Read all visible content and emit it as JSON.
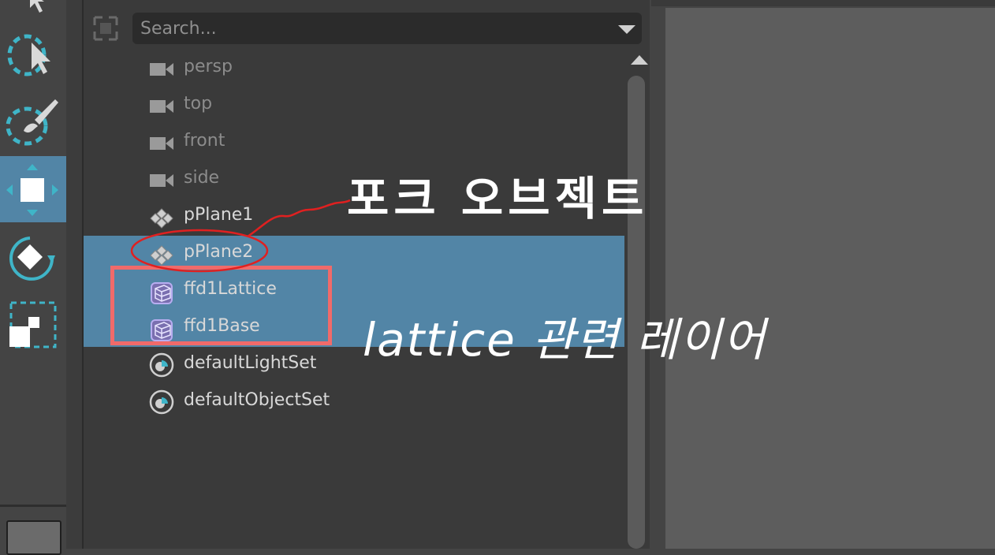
{
  "search": {
    "placeholder": "Search..."
  },
  "outliner_items": [
    {
      "label": "persp",
      "icon": "camera-icon",
      "dim": true
    },
    {
      "label": "top",
      "icon": "camera-icon",
      "dim": true
    },
    {
      "label": "front",
      "icon": "camera-icon",
      "dim": true
    },
    {
      "label": "side",
      "icon": "camera-icon",
      "dim": true
    },
    {
      "label": "pPlane1",
      "icon": "mesh-icon",
      "dim": false
    },
    {
      "label": "pPlane2",
      "icon": "mesh-icon",
      "dim": false,
      "selected": true
    },
    {
      "label": "ffd1Lattice",
      "icon": "lattice-icon",
      "dim": false,
      "selected": true
    },
    {
      "label": "ffd1Base",
      "icon": "lattice-icon",
      "dim": false,
      "selected": true
    },
    {
      "label": "defaultLightSet",
      "icon": "set-icon",
      "dim": false
    },
    {
      "label": "defaultObjectSet",
      "icon": "set-icon",
      "dim": false
    }
  ],
  "annotations": {
    "fork_object": "포크 오브젝트",
    "lattice_layers": "lattice 관련 레이어"
  },
  "colors": {
    "selection": "#5285a6",
    "highlight_box": "#f06a6a",
    "circle_mark": "#e02020"
  },
  "tools": [
    "select-tool-icon",
    "lasso-tool-icon",
    "paint-select-tool-icon",
    "move-tool-icon",
    "rotate-tool-icon",
    "scale-tool-icon"
  ]
}
